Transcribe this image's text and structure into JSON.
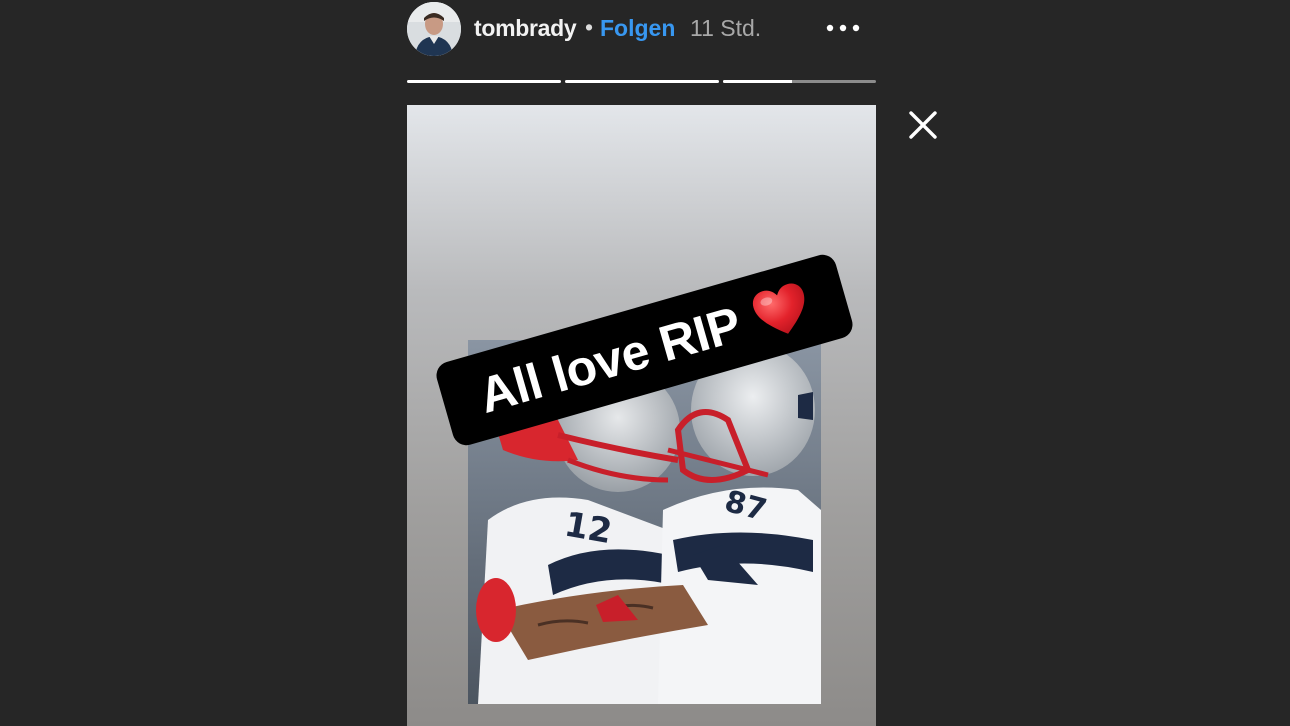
{
  "header": {
    "username": "tombrady",
    "separator": "•",
    "follow_label": "Folgen",
    "timestamp": "11 Std.",
    "avatar_icon": "profile-photo",
    "more_icon": "more-options-icon"
  },
  "progress": {
    "segments": [
      {
        "fill": 1.0
      },
      {
        "fill": 1.0
      },
      {
        "fill": 0.45
      }
    ]
  },
  "close_icon": "close-icon",
  "story": {
    "sticker_text": "All love RIP",
    "sticker_emoji": "heart-icon",
    "photo_description_icon": "photo"
  },
  "colors": {
    "background": "#262626",
    "follow": "#3897f0",
    "heart": "#e0202a",
    "sticker": "#000000"
  }
}
